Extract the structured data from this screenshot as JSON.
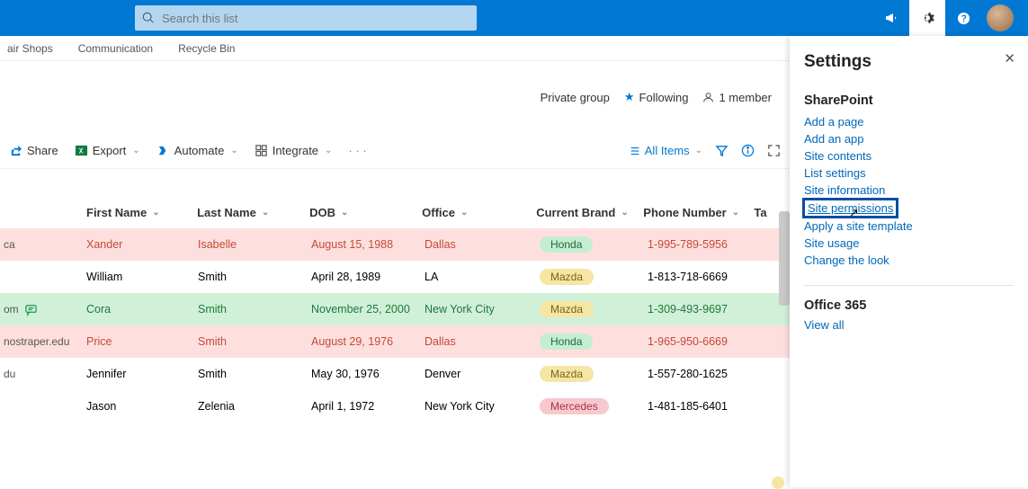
{
  "header": {
    "search_placeholder": "Search this list"
  },
  "nav": {
    "items": [
      "air Shops",
      "Communication",
      "Recycle Bin"
    ]
  },
  "meta": {
    "group": "Private group",
    "following": "Following",
    "members": "1 member"
  },
  "commands": {
    "share": "Share",
    "export": "Export",
    "automate": "Automate",
    "integrate": "Integrate",
    "view": "All Items"
  },
  "columns": {
    "first": "First Name",
    "last": "Last Name",
    "dob": "DOB",
    "office": "Office",
    "brand": "Current Brand",
    "phone": "Phone Number",
    "ta": "Ta"
  },
  "rows": [
    {
      "pre": "ca",
      "first": "Xander",
      "last": "Isabelle",
      "dob": "August 15, 1988",
      "office": "Dallas",
      "brand": "Honda",
      "brand_class": "honda",
      "phone": "1-995-789-5956",
      "row_class": "pink",
      "comment": false
    },
    {
      "pre": "",
      "first": "William",
      "last": "Smith",
      "dob": "April 28, 1989",
      "office": "LA",
      "brand": "Mazda",
      "brand_class": "mazda",
      "phone": "1-813-718-6669",
      "row_class": "",
      "comment": false
    },
    {
      "pre": "om",
      "first": "Cora",
      "last": "Smith",
      "dob": "November 25, 2000",
      "office": "New York City",
      "brand": "Mazda",
      "brand_class": "mazda",
      "phone": "1-309-493-9697",
      "row_class": "green",
      "comment": true
    },
    {
      "pre": "nostraper.edu",
      "first": "Price",
      "last": "Smith",
      "dob": "August 29, 1976",
      "office": "Dallas",
      "brand": "Honda",
      "brand_class": "honda",
      "phone": "1-965-950-6669",
      "row_class": "pink",
      "comment": false
    },
    {
      "pre": "du",
      "first": "Jennifer",
      "last": "Smith",
      "dob": "May 30, 1976",
      "office": "Denver",
      "brand": "Mazda",
      "brand_class": "mazda",
      "phone": "1-557-280-1625",
      "row_class": "",
      "comment": false
    },
    {
      "pre": "",
      "first": "Jason",
      "last": "Zelenia",
      "dob": "April 1, 1972",
      "office": "New York City",
      "brand": "Mercedes",
      "brand_class": "mercedes",
      "phone": "1-481-185-6401",
      "row_class": "",
      "comment": false
    }
  ],
  "panel": {
    "title": "Settings",
    "section1": "SharePoint",
    "links1": [
      "Add a page",
      "Add an app",
      "Site contents",
      "List settings",
      "Site information",
      "Site permissions",
      "Apply a site template",
      "Site usage",
      "Change the look"
    ],
    "highlight_index": 5,
    "section2": "Office 365",
    "view_all": "View all"
  }
}
